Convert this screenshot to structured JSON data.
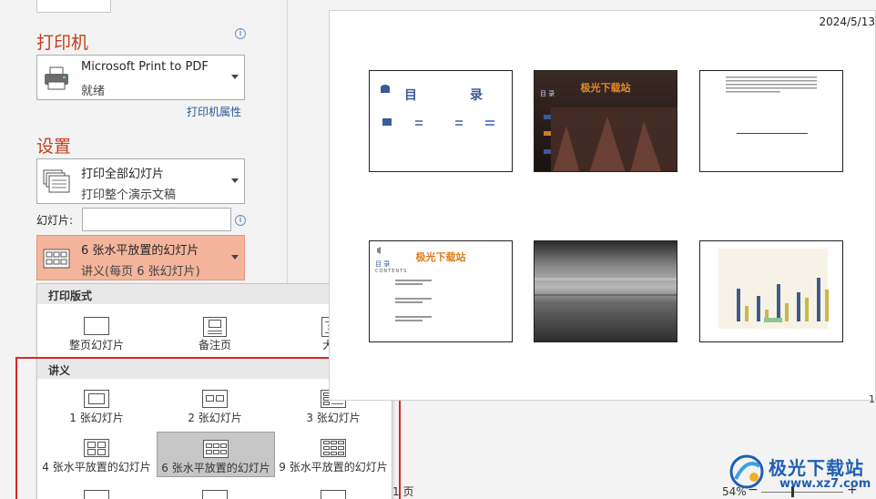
{
  "printer": {
    "section_title": "打印机",
    "name": "Microsoft Print to PDF",
    "status": "就绪",
    "properties_link": "打印机属性",
    "info": "i"
  },
  "settings": {
    "section_title": "设置",
    "range_main": "打印全部幻灯片",
    "range_sub": "打印整个演示文稿",
    "slides_label": "幻灯片:",
    "slides_value": "",
    "layout_main": "6 张水平放置的幻灯片",
    "layout_sub": "讲义(每页 6 张幻灯片)",
    "info": "i"
  },
  "layout_menu": {
    "print_layout_header": "打印版式",
    "print_layouts": [
      "整页幻灯片",
      "备注页",
      "大纲"
    ],
    "handouts_header": "讲义",
    "handouts_row1": [
      "1 张幻灯片",
      "2 张幻灯片",
      "3 张幻灯片"
    ],
    "handouts_row2": [
      "4 张水平放置的幻灯片",
      "6 张水平放置的幻灯片",
      "9 张水平放置的幻灯片"
    ],
    "selected": "6 张水平放置的幻灯片"
  },
  "preview": {
    "date": "2024/5/13",
    "page_number_right": "1",
    "thumbs": {
      "t1_left": "目",
      "t1_right": "录",
      "t2_title": "极光下载站",
      "t2_sub": "目 录",
      "t4_title": "极光下载站",
      "t4_sub": "目 录",
      "t4_contents": "CONTENTS"
    },
    "chart_bars": [
      {
        "value": 0.62,
        "color": "#3f5a8a"
      },
      {
        "value": 0.3,
        "color": "#c9b84a"
      },
      {
        "value": 0.48,
        "color": "#3f5a8a"
      },
      {
        "value": 0.22,
        "color": "#c9b84a"
      },
      {
        "value": 0.7,
        "color": "#3f5a8a"
      },
      {
        "value": 0.34,
        "color": "#c9b84a"
      },
      {
        "value": 0.55,
        "color": "#3f5a8a"
      },
      {
        "value": 0.44,
        "color": "#c9b84a"
      },
      {
        "value": 0.82,
        "color": "#3f5a8a"
      },
      {
        "value": 0.6,
        "color": "#c9b84a"
      }
    ]
  },
  "footer": {
    "page_count": "1 页",
    "zoom_level": "54%",
    "zoom_minus": "−",
    "zoom_plus": "+",
    "zoom_fraction": 0.37
  },
  "watermark": {
    "text": "极光下载站",
    "url": "www.xz7.com"
  },
  "colors": {
    "accent": "#c43e1c",
    "selected_dropdown": "#f4b59c",
    "highlight_frame": "#d62828",
    "link": "#2b579a"
  }
}
